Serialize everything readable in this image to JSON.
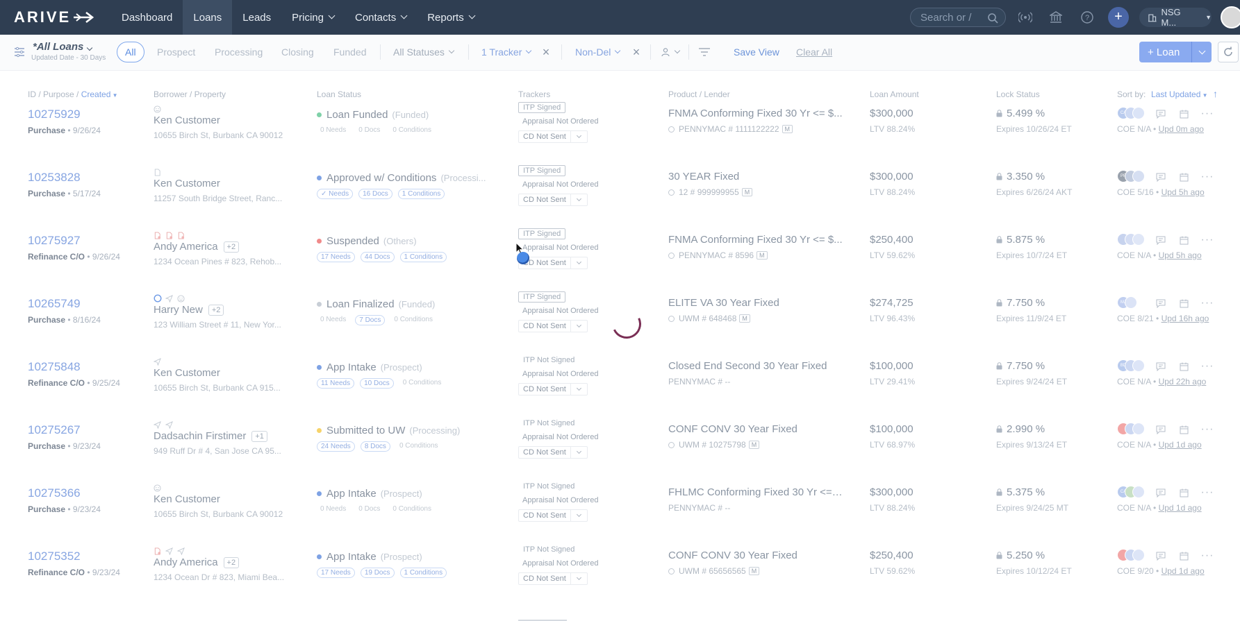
{
  "app": {
    "logo_text": "ARIVE"
  },
  "nav": {
    "items": [
      {
        "label": "Dashboard",
        "dropdown": false,
        "active": false
      },
      {
        "label": "Loans",
        "dropdown": false,
        "active": true
      },
      {
        "label": "Leads",
        "dropdown": false,
        "active": false
      },
      {
        "label": "Pricing",
        "dropdown": true,
        "active": false
      },
      {
        "label": "Contacts",
        "dropdown": true,
        "active": false
      },
      {
        "label": "Reports",
        "dropdown": true,
        "active": false
      }
    ],
    "search_placeholder": "Search or /",
    "org_label": "NSG M..."
  },
  "filters": {
    "view_name": "*All Loans",
    "view_sub": "Updated Date - 30 Days",
    "all_label": "All",
    "stages": [
      "Prospect",
      "Processing",
      "Closing",
      "Funded"
    ],
    "status_filter": "All Statuses",
    "tracker_filter": "1 Tracker",
    "channel_filter": "Non-Del",
    "save_view": "Save View",
    "clear_all": "Clear All",
    "new_loan": "+ Loan"
  },
  "columns": {
    "id_prefix": "ID / Purpose / ",
    "id_sort": "Created",
    "borrower": "Borrower / Property",
    "loan_status": "Loan Status",
    "trackers": "Trackers",
    "product": "Product / Lender",
    "amount": "Loan Amount",
    "lock": "Lock Status",
    "sort_by": "Sort by:",
    "sort_value": "Last Updated"
  },
  "colors": {
    "nav_bg": "#2f3e52",
    "accent": "#5b8ce0",
    "status_funded": "#7fd1a8",
    "status_approved": "#7ea2e4",
    "status_suspended": "#f08a8a",
    "status_finalized": "#c8ced6",
    "status_intake": "#7ea2e4",
    "status_uw": "#f6d36a"
  },
  "rows": [
    {
      "id": "10275929",
      "purpose": "Purchase",
      "date": "9/26/24",
      "icons": [
        "smiley-icon"
      ],
      "borrower": "Ken Customer",
      "extra": "",
      "address": "10655 Birch St, Burbank CA 90012",
      "status": "Loan Funded",
      "stage": "(Funded)",
      "dot": "status_funded",
      "needs": "0 Needs",
      "docs": "0 Docs",
      "conditions": "0 Conditions",
      "pill_needs": false,
      "pill_docs": false,
      "pill_cond": false,
      "itp": "ITP Signed",
      "itp_boxed": true,
      "appraisal": "Appraisal Not Ordered",
      "cd": "CD Not Sent",
      "product": "FNMA Conforming Fixed 30 Yr <= $...",
      "lender": "PENNYMAC # 1111122222",
      "lender_m": true,
      "lender_ring": true,
      "amount": "$300,000",
      "ltv": "LTV 88.24%",
      "rate": "5.499 %",
      "expires": "Expires 10/26/24 ET",
      "coe": "COE N/A",
      "upd": "Upd 0m ago"
    },
    {
      "id": "10253828",
      "purpose": "Purchase",
      "date": "5/17/24",
      "icons": [
        "document-icon"
      ],
      "borrower": "Ken Customer",
      "extra": "",
      "address": "11257 South Bridge Street, Ranc...",
      "status": "Approved w/ Conditions",
      "stage": "(Processi...",
      "dot": "status_approved",
      "needs": "✓ Needs",
      "docs": "16 Docs",
      "conditions": "1 Conditions",
      "pill_needs": true,
      "pill_docs": true,
      "pill_cond": true,
      "itp": "ITP Signed",
      "itp_boxed": true,
      "appraisal": "Appraisal Not Ordered",
      "cd": "CD Not Sent",
      "product": "30 YEAR Fixed",
      "lender": "12 # 999999955",
      "lender_m": true,
      "lender_ring": true,
      "amount": "$300,000",
      "ltv": "LTV 88.24%",
      "rate": "3.350 %",
      "expires": "Expires 6/26/24 AKT",
      "coe": "COE 5/16",
      "upd": "Upd 5h ago"
    },
    {
      "id": "10275927",
      "purpose": "Refinance C/O",
      "date": "9/26/24",
      "icons": [
        "document-red-icon",
        "document-red-icon",
        "document-red-icon"
      ],
      "borrower": "Andy America",
      "extra": "+2",
      "address": "1234 Ocean Pines # 823, Rehob...",
      "status": "Suspended",
      "stage": "(Others)",
      "dot": "status_suspended",
      "needs": "17 Needs",
      "docs": "44 Docs",
      "conditions": "1 Conditions",
      "pill_needs": true,
      "pill_docs": true,
      "pill_cond": true,
      "itp": "ITP Signed",
      "itp_boxed": true,
      "appraisal": "Appraisal Not Ordered",
      "cd": "CD Not Sent",
      "product": "FNMA Conforming Fixed 30 Yr <= $...",
      "lender": "PENNYMAC # 8596",
      "lender_m": true,
      "lender_ring": true,
      "amount": "$250,400",
      "ltv": "LTV 59.62%",
      "rate": "5.875 %",
      "expires": "Expires 10/7/24 ET",
      "coe": "COE N/A",
      "upd": "Upd 5h ago"
    },
    {
      "id": "10265749",
      "purpose": "Purchase",
      "date": "8/16/24",
      "icons": [
        "circle-icon",
        "send-icon",
        "smiley-icon"
      ],
      "borrower": "Harry New",
      "extra": "+2",
      "address": "123 William Street # 11, New Yor...",
      "status": "Loan Finalized",
      "stage": "(Funded)",
      "dot": "status_finalized",
      "needs": "0 Needs",
      "docs": "7 Docs",
      "conditions": "0 Conditions",
      "pill_needs": false,
      "pill_docs": true,
      "pill_cond": false,
      "itp": "ITP Signed",
      "itp_boxed": true,
      "appraisal": "Appraisal Not Ordered",
      "cd": "CD Not Sent",
      "product": "ELITE VA 30 Year Fixed",
      "lender": "UWM # 648468",
      "lender_m": true,
      "lender_ring": true,
      "amount": "$274,725",
      "ltv": "LTV 96.43%",
      "rate": "7.750 %",
      "expires": "Expires 11/9/24 ET",
      "coe": "COE 8/21",
      "upd": "Upd 16h ago"
    },
    {
      "id": "10275848",
      "purpose": "Refinance C/O",
      "date": "9/25/24",
      "icons": [
        "send-icon"
      ],
      "borrower": "Ken Customer",
      "extra": "",
      "address": "10655 Birch St, Burbank CA 915...",
      "status": "App Intake",
      "stage": "(Prospect)",
      "dot": "status_intake",
      "needs": "11 Needs",
      "docs": "10 Docs",
      "conditions": "0 Conditions",
      "pill_needs": true,
      "pill_docs": true,
      "pill_cond": false,
      "itp": "ITP Not Signed",
      "itp_boxed": false,
      "appraisal": "Appraisal Not Ordered",
      "cd": "CD Not Sent",
      "product": "Closed End Second 30 Year Fixed",
      "lender": "PENNYMAC # --",
      "lender_m": false,
      "lender_ring": false,
      "amount": "$100,000",
      "ltv": "LTV 29.41%",
      "rate": "7.750 %",
      "expires": "Expires 9/24/24 ET",
      "coe": "COE N/A",
      "upd": "Upd 22h ago"
    },
    {
      "id": "10275267",
      "purpose": "Purchase",
      "date": "9/23/24",
      "icons": [
        "send-icon",
        "send-icon"
      ],
      "borrower": "Dadsachin Firstimer",
      "extra": "+1",
      "address": "949 Ruff Dr # 4, San Jose CA 95...",
      "status": "Submitted to UW",
      "stage": "(Processing)",
      "dot": "status_uw",
      "needs": "24 Needs",
      "docs": "8 Docs",
      "conditions": "0 Conditions",
      "pill_needs": true,
      "pill_docs": true,
      "pill_cond": false,
      "itp": "ITP Not Signed",
      "itp_boxed": false,
      "appraisal": "Appraisal Not Ordered",
      "cd": "CD Not Sent",
      "product": "CONF CONV 30 Year Fixed",
      "lender": "UWM # 10275798",
      "lender_m": true,
      "lender_ring": true,
      "amount": "$100,000",
      "ltv": "LTV 68.97%",
      "rate": "2.990 %",
      "expires": "Expires 9/13/24 ET",
      "coe": "COE N/A",
      "upd": "Upd 1d ago"
    },
    {
      "id": "10275366",
      "purpose": "Purchase",
      "date": "9/23/24",
      "icons": [
        "smiley-icon"
      ],
      "borrower": "Ken Customer",
      "extra": "",
      "address": "10655 Birch St, Burbank CA 90012",
      "status": "App Intake",
      "stage": "(Prospect)",
      "dot": "status_intake",
      "needs": "0 Needs",
      "docs": "0 Docs",
      "conditions": "0 Conditions",
      "pill_needs": false,
      "pill_docs": false,
      "pill_cond": false,
      "itp": "ITP Not Signed",
      "itp_boxed": false,
      "appraisal": "Appraisal Not Ordered",
      "cd": "CD Not Sent",
      "product": "FHLMC Conforming Fixed 30 Yr <= ...",
      "lender": "PENNYMAC # --",
      "lender_m": false,
      "lender_ring": false,
      "amount": "$300,000",
      "ltv": "LTV 88.24%",
      "rate": "5.375 %",
      "expires": "Expires 9/24/25 MT",
      "coe": "COE N/A",
      "upd": "Upd 1d ago"
    },
    {
      "id": "10275352",
      "purpose": "Refinance C/O",
      "date": "9/23/24",
      "icons": [
        "document-red-icon",
        "send-icon",
        "send-icon"
      ],
      "borrower": "Andy America",
      "extra": "+2",
      "address": "1234 Ocean Dr # 823, Miami Bea...",
      "status": "App Intake",
      "stage": "(Prospect)",
      "dot": "status_intake",
      "needs": "17 Needs",
      "docs": "19 Docs",
      "conditions": "1 Conditions",
      "pill_needs": true,
      "pill_docs": true,
      "pill_cond": true,
      "itp": "ITP Not Signed",
      "itp_boxed": false,
      "appraisal": "Appraisal Not Ordered",
      "cd": "CD Not Sent",
      "product": "CONF CONV 30 Year Fixed",
      "lender": "UWM # 65656565",
      "lender_m": true,
      "lender_ring": true,
      "amount": "$250,400",
      "ltv": "LTV 59.62%",
      "rate": "5.250 %",
      "expires": "Expires 10/12/24 ET",
      "coe": "COE 9/20",
      "upd": "Upd 1d ago"
    }
  ]
}
